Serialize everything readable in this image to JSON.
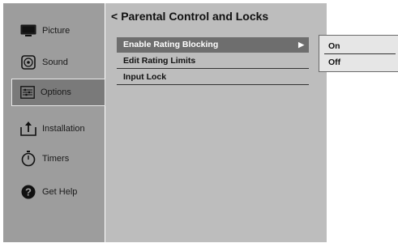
{
  "sidebar": {
    "items": [
      {
        "label": "Picture",
        "icon": "tv-icon"
      },
      {
        "label": "Sound",
        "icon": "speaker-icon"
      },
      {
        "label": "Options",
        "icon": "options-icon",
        "selected": true
      },
      {
        "label": "Installation",
        "icon": "installation-icon"
      },
      {
        "label": "Timers",
        "icon": "stopwatch-icon"
      },
      {
        "label": "Get Help",
        "icon": "help-icon"
      }
    ]
  },
  "main": {
    "back_symbol": "<",
    "title": "Parental Control and Locks",
    "menu": [
      {
        "label": "Enable Rating Blocking",
        "highlighted": true,
        "submenu_arrow": "▶"
      },
      {
        "label": "Edit Rating Limits"
      },
      {
        "label": "Input Lock"
      }
    ]
  },
  "popup": {
    "options": [
      {
        "label": "On"
      },
      {
        "label": "Off"
      }
    ]
  },
  "colors": {
    "sidebar_bg": "#9d9d9d",
    "main_bg": "#bdbdbd",
    "highlight_bg": "#6e6e6e",
    "popup_bg": "#e6e6e6"
  }
}
